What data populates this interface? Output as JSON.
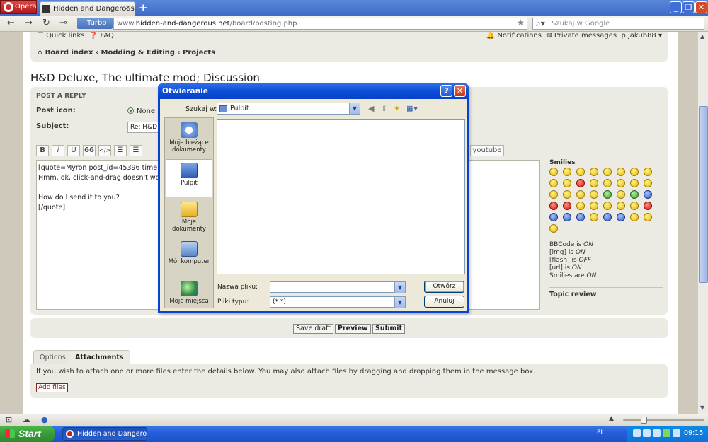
{
  "browser": {
    "app_button": "Opera",
    "tab_title": "Hidden and Dangerous ....",
    "turbo_label": "Turbo",
    "url_prefix": "www.",
    "url_host": "hidden-and-dangerous.net",
    "url_path": "/board/posting.php",
    "search_placeholder": "Szukaj w Google"
  },
  "forum": {
    "quick_links": "Quick links",
    "faq": "FAQ",
    "notifications": "Notifications",
    "private_messages": "Private messages",
    "username": "p.jakub88",
    "breadcrumb": [
      "Board index",
      "Modding & Editing",
      "Projects"
    ],
    "topic_title": "H&D Deluxe, The ultimate mod; Discussion",
    "section_heading": "POST A REPLY",
    "post_icon_label": "Post icon:",
    "post_icon_none": "None",
    "subject_label": "Subject:",
    "subject_value": "Re: H&D",
    "bbcode_buttons": [
      "B",
      "i",
      "U",
      "66",
      "</>",
      "☰",
      "☰"
    ],
    "youtube_button": "youtube",
    "message_lines": [
      "[quote=Myron post_id=45396 time=15",
      "Hmm, ok, click-and-drag doesn't wor",
      "",
      "How do I send it to you?",
      "[/quote]"
    ],
    "smilies_heading": "Smilies",
    "bbcode_status": [
      {
        "label": "BBCode is ",
        "state": "ON"
      },
      {
        "label": "[img] is ",
        "state": "ON"
      },
      {
        "label": "[flash] is ",
        "state": "OFF"
      },
      {
        "label": "[url] is ",
        "state": "ON"
      },
      {
        "label": "Smilies are ",
        "state": "ON"
      }
    ],
    "topic_review": "Topic review",
    "save_draft": "Save draft",
    "preview": "Preview",
    "submit": "Submit",
    "tab_options": "Options",
    "tab_attachments": "Attachments",
    "attach_text": "If you wish to attach one or more files enter the details below. You may also attach files by dragging and dropping them in the message box.",
    "add_files": "Add files"
  },
  "dialog": {
    "title": "Otwieranie",
    "look_in_label": "Szukaj w:",
    "look_in_value": "Pulpit",
    "places": [
      "Moje bieżące dokumenty",
      "Pulpit",
      "Moje dokumenty",
      "Mój komputer",
      "Moje miejsca"
    ],
    "filename_label": "Nazwa pliku:",
    "filename_value": "",
    "filetype_label": "Pliki typu:",
    "filetype_value": "(*.*)",
    "open_button": "Otwórz",
    "cancel_button": "Anuluj"
  },
  "taskbar": {
    "start": "Start",
    "item": "Hidden and Dangerou...",
    "language": "PL",
    "clock": "09:15"
  }
}
